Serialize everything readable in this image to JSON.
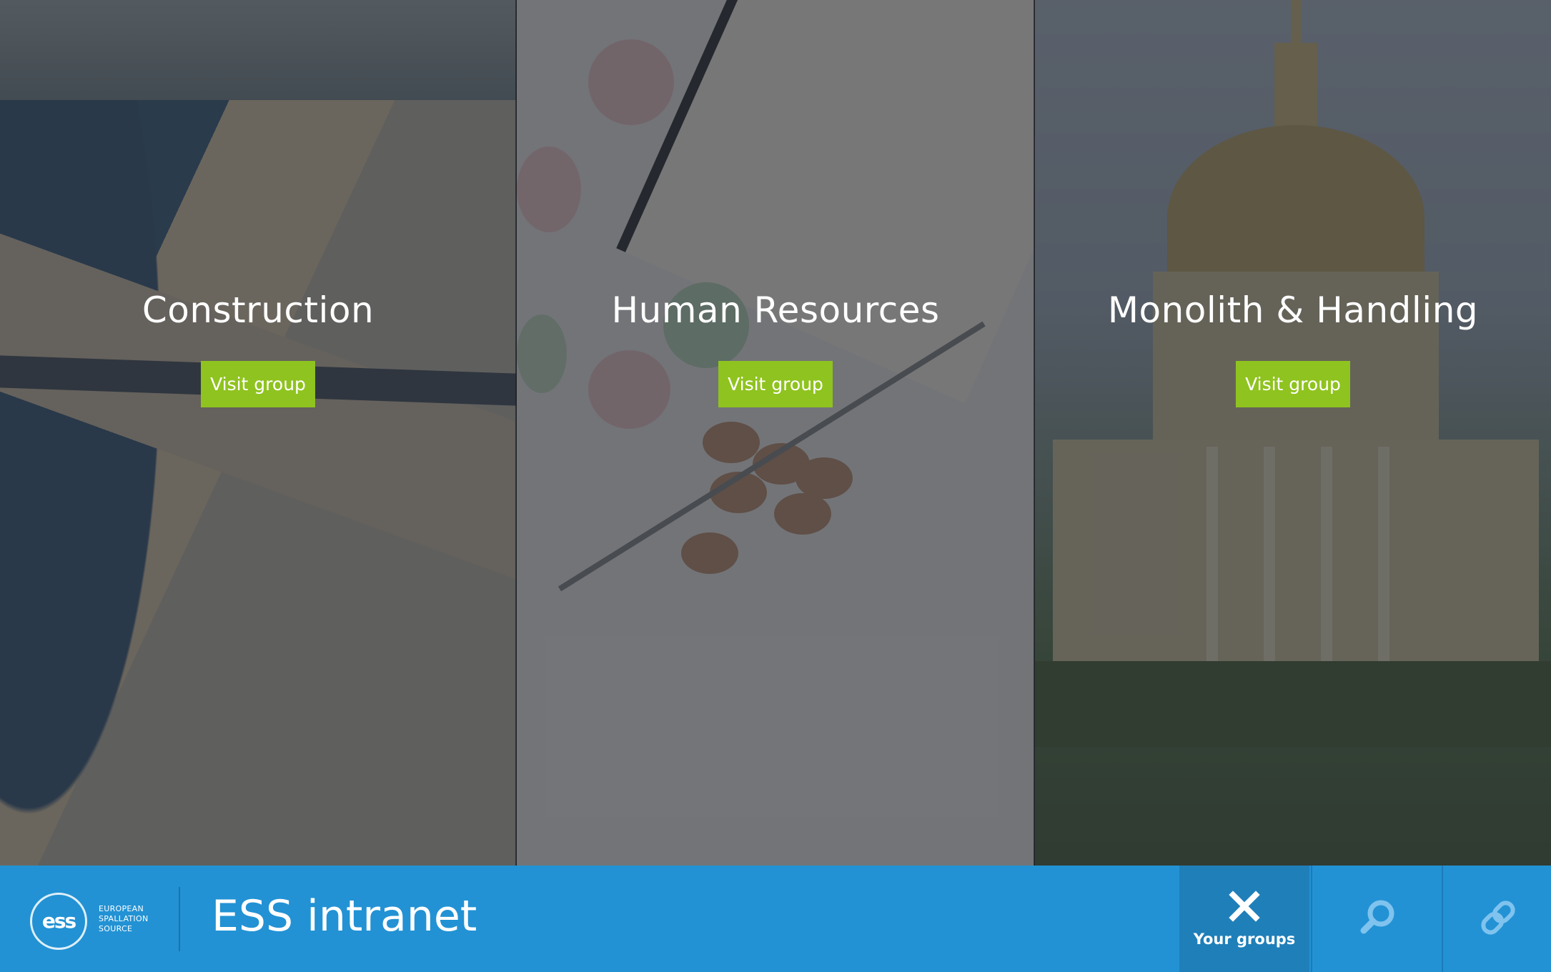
{
  "panels": [
    {
      "title": "Construction",
      "button_label": "Visit group"
    },
    {
      "title": "Human Resources",
      "button_label": "Visit group"
    },
    {
      "title": "Monolith & Handling",
      "button_label": "Visit group"
    }
  ],
  "footer": {
    "logo_mark": "ess",
    "logo_lines": [
      "EUROPEAN",
      "SPALLATION",
      "SOURCE"
    ],
    "site_title": "ESS intranet",
    "nav": [
      {
        "label": "Your groups",
        "icon": "close-icon"
      },
      {
        "label": "",
        "icon": "search-icon"
      },
      {
        "label": "",
        "icon": "link-icon"
      }
    ]
  },
  "colors": {
    "accent_green": "#8fc31f",
    "bar_blue": "#2292d4",
    "bar_blue_active": "#1f7fb9",
    "icon_light_blue": "#7fc3ee"
  }
}
